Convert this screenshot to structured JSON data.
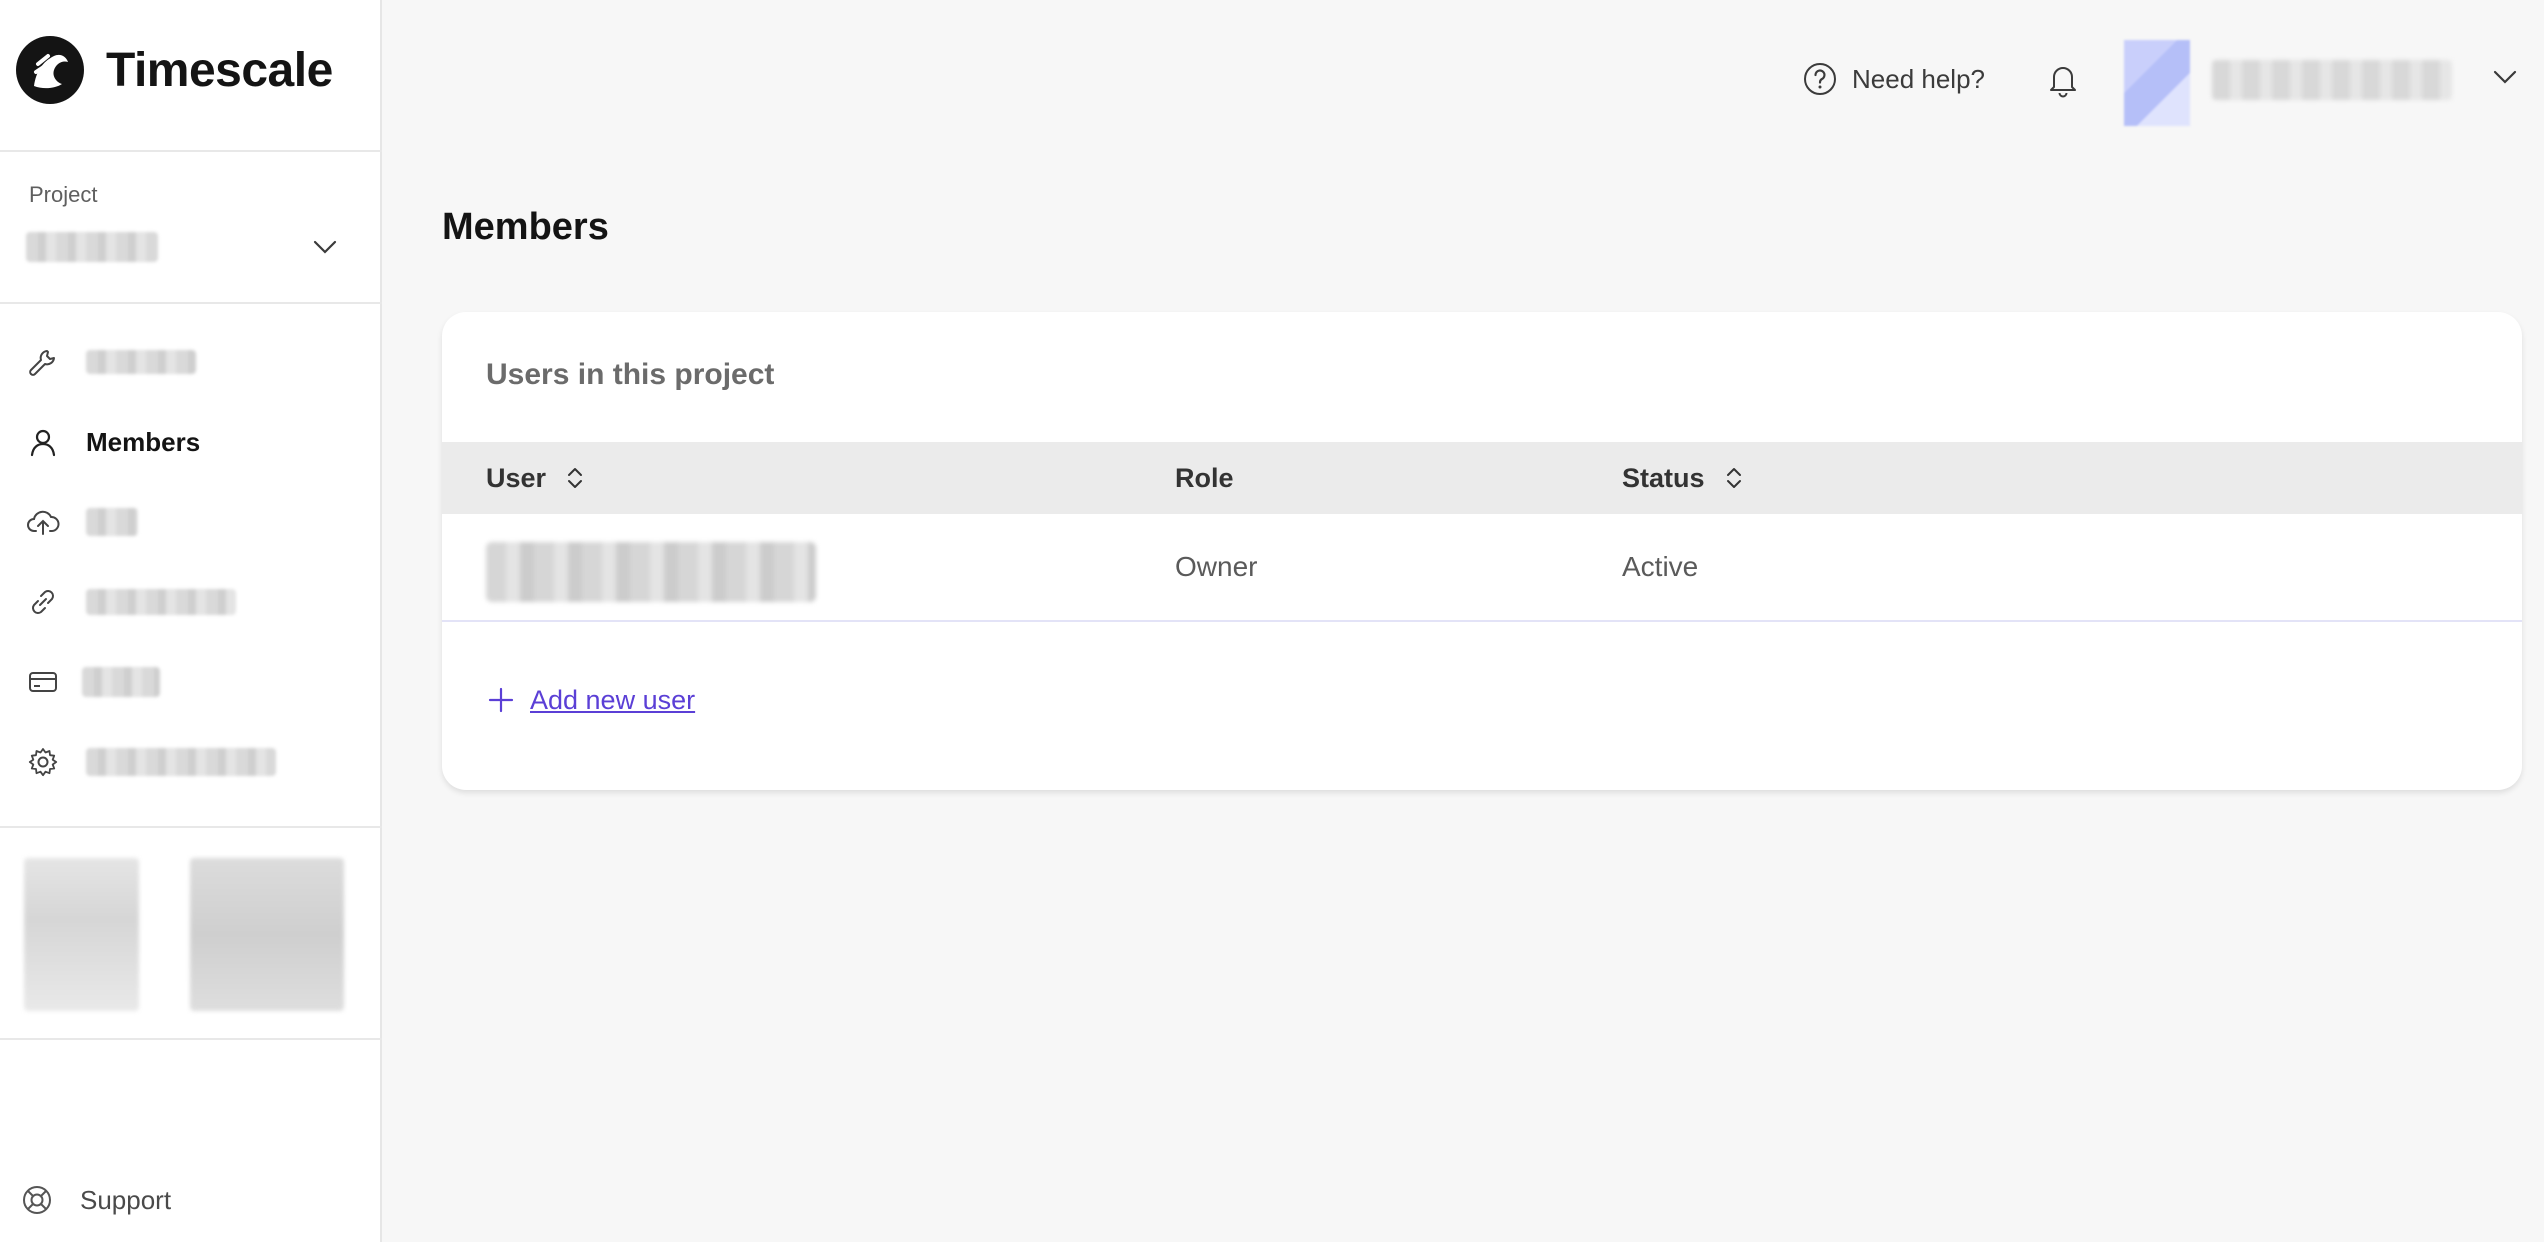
{
  "brand": {
    "name": "Timescale"
  },
  "project": {
    "label": "Project",
    "value": "redacted"
  },
  "sidebar": {
    "items": [
      {
        "label": "redacted",
        "icon": "wrench-icon",
        "active": false
      },
      {
        "label": "Members",
        "icon": "user-icon",
        "active": true
      },
      {
        "label": "redacted",
        "icon": "cloud-upload-icon",
        "active": false
      },
      {
        "label": "redacted",
        "icon": "link-icon",
        "active": false
      },
      {
        "label": "redacted",
        "icon": "credit-card-icon",
        "active": false
      },
      {
        "label": "redacted",
        "icon": "gear-icon",
        "active": false
      }
    ],
    "support_label": "Support"
  },
  "header": {
    "help_label": "Need help?",
    "account_name": "redacted"
  },
  "main": {
    "title": "Members",
    "card": {
      "title": "Users in this project",
      "columns": [
        {
          "label": "User",
          "sortable": true
        },
        {
          "label": "Role",
          "sortable": false
        },
        {
          "label": "Status",
          "sortable": true
        }
      ],
      "rows": [
        {
          "user": "redacted",
          "role": "Owner",
          "status": "Active"
        }
      ],
      "add_user_label": "Add new user"
    }
  },
  "colors": {
    "accent": "#5b3fd6",
    "sidebar_bg": "#ffffff",
    "page_bg": "#f7f7f7",
    "table_header_bg": "#ebebeb"
  }
}
